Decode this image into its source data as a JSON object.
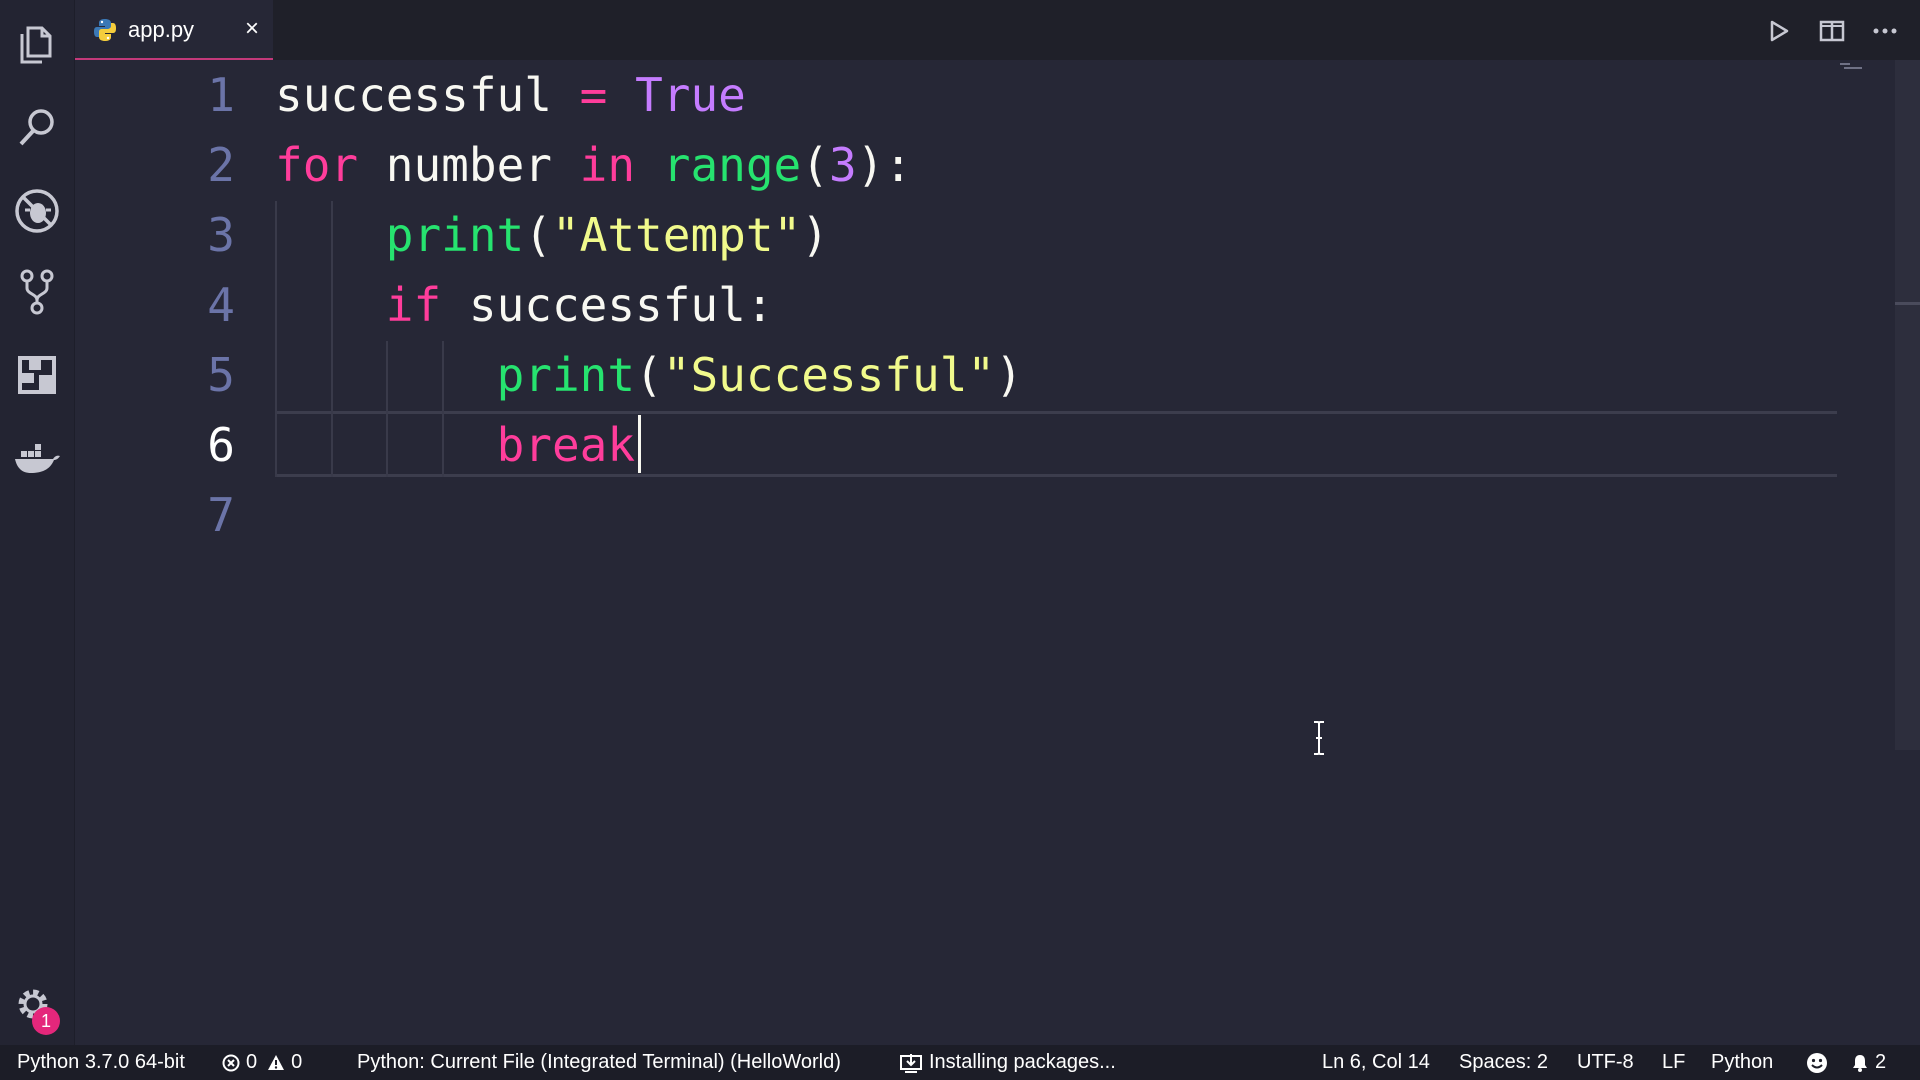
{
  "tab": {
    "file_name": "app.py",
    "file_icon": "python-icon",
    "close_glyph": "×"
  },
  "activity_bar": {
    "items": [
      {
        "name": "explorer",
        "icon": "files-icon"
      },
      {
        "name": "search",
        "icon": "search-icon"
      },
      {
        "name": "debug",
        "icon": "debug-icon"
      },
      {
        "name": "source-control",
        "icon": "source-control-icon"
      },
      {
        "name": "extensions",
        "icon": "extensions-icon"
      },
      {
        "name": "docker",
        "icon": "docker-icon"
      }
    ],
    "settings_badge": "1"
  },
  "editor_actions": [
    "run-icon",
    "split-editor-icon",
    "more-icon"
  ],
  "editor": {
    "active_line": 6,
    "lines": [
      {
        "no": "1"
      },
      {
        "no": "2"
      },
      {
        "no": "3"
      },
      {
        "no": "4"
      },
      {
        "no": "5"
      },
      {
        "no": "6"
      },
      {
        "no": "7"
      }
    ],
    "code": {
      "l1": [
        "successful",
        " ",
        "=",
        " ",
        "True"
      ],
      "l2": [
        "for",
        " ",
        "number",
        " ",
        "in",
        " ",
        "range",
        "(",
        "3",
        "):"
      ],
      "l3": [
        "    ",
        "print",
        "(",
        "\"Attempt\"",
        ")"
      ],
      "l4": [
        "    ",
        "if",
        " ",
        "successful",
        ":"
      ],
      "l5": [
        "        ",
        "print",
        "(",
        "\"Successful\"",
        ")"
      ],
      "l6": [
        "        ",
        "break"
      ],
      "l7": [
        ""
      ]
    }
  },
  "status_bar": {
    "interpreter": "Python 3.7.0 64-bit",
    "errors": "0",
    "warnings": "0",
    "debug_config": "Python: Current File (Integrated Terminal) (HelloWorld)",
    "task": "Installing packages...",
    "cursor_position": "Ln 6, Col 14",
    "indentation": "Spaces: 2",
    "encoding": "UTF-8",
    "eol": "LF",
    "language": "Python",
    "notifications": "2"
  },
  "colors": {
    "keyword": "#ff3d9b",
    "constant": "#c57cff",
    "function": "#26e36f",
    "string": "#f1fa8c",
    "tab_accent": "#c3397a",
    "badge": "#e4277b"
  }
}
